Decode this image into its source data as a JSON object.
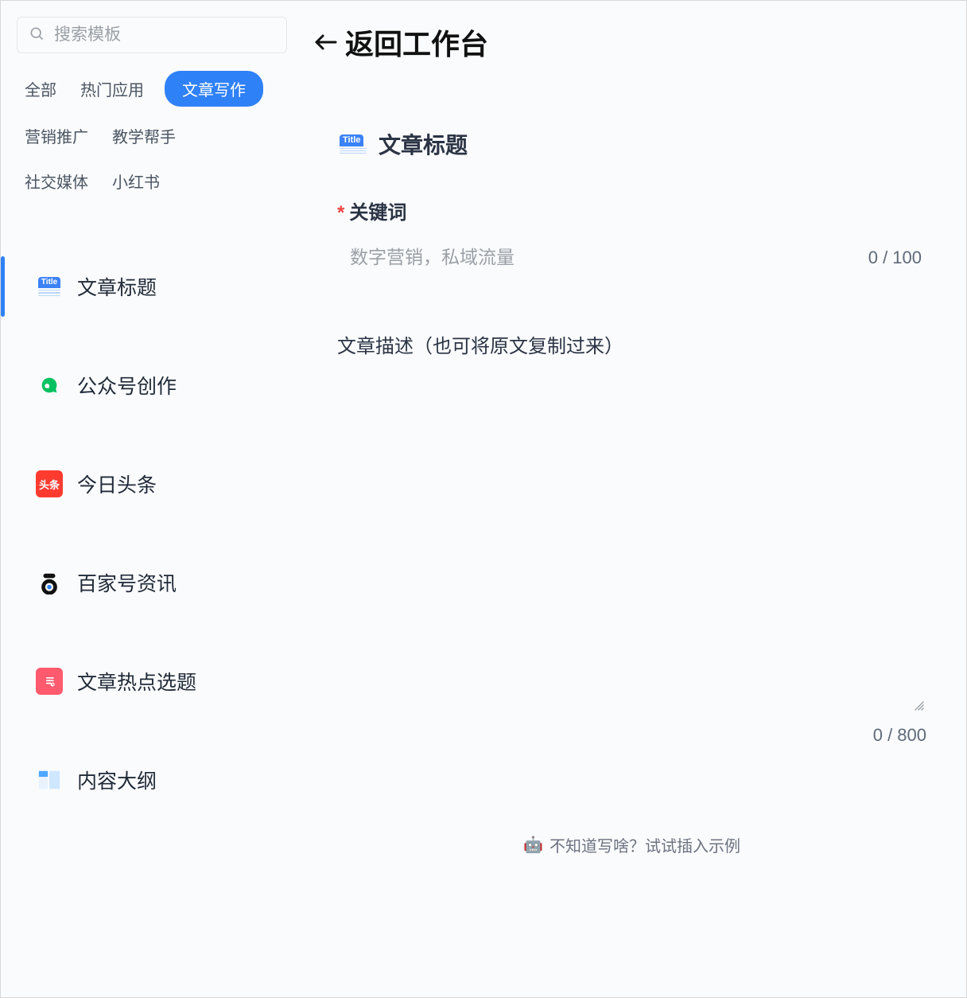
{
  "sidebar": {
    "search_placeholder": "搜索模板",
    "tags": {
      "all": "全部",
      "popular": "热门应用",
      "article_writing": "文章写作",
      "marketing": "营销推广",
      "teaching": "教学帮手",
      "social": "社交媒体",
      "xiaohongshu": "小红书"
    },
    "templates": {
      "article_title": "文章标题",
      "wechat_creation": "公众号创作",
      "toutiao": "今日头条",
      "baijiahao": "百家号资讯",
      "article_hotspot": "文章热点选题",
      "content_outline": "内容大纲"
    }
  },
  "main": {
    "back_label": "返回工作台",
    "page_title": "文章标题",
    "field1": {
      "label": "关键词",
      "placeholder": "数字营销，私域流量",
      "counter": "0 / 100"
    },
    "field2": {
      "label": "文章描述（也可将原文复制过来）",
      "counter": "0 / 800"
    },
    "hint": "不知道写啥？试试插入示例"
  },
  "icons": {
    "title_badge_text": "Title",
    "toutiao_text": "头条"
  }
}
